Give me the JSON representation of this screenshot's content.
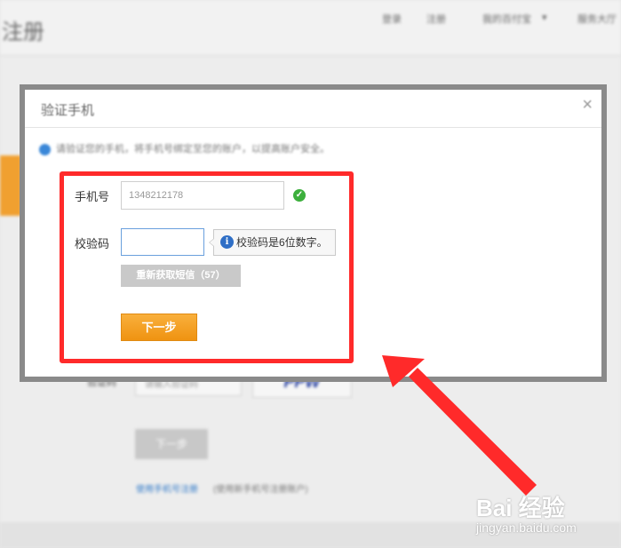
{
  "background": {
    "title": "注册",
    "nav": [
      "登录",
      "注册",
      "我的百付宝",
      "服务大厅"
    ],
    "captcha_label": "验证码",
    "captcha_input_placeholder": "请输入验证码",
    "captcha_image_text": "PPW",
    "next_label": "下一步",
    "link_text": "使用手机号注册",
    "link_note": "(使用新手机号注册账户)"
  },
  "dialog": {
    "title": "验证手机",
    "close_label": "×",
    "notice": "请验证您的手机，将手机号绑定至您的账户，以提高账户安全。",
    "phone_label": "手机号",
    "phone_value": "1348212178",
    "code_label": "校验码",
    "code_value": "",
    "tip_icon": "i",
    "tip_text": "校验码是6位数字。",
    "resend_label": "重新获取短信（57）",
    "next_label": "下一步"
  },
  "colors": {
    "highlight_box": "#ff2a2a",
    "arrow": "#ff2a2a",
    "primary_button": "#f5a623",
    "input_focus": "#6aa0dd",
    "success": "#3caf3c"
  },
  "watermark": {
    "main": "Bai 经验",
    "sub": "jingyan.baidu.com"
  }
}
